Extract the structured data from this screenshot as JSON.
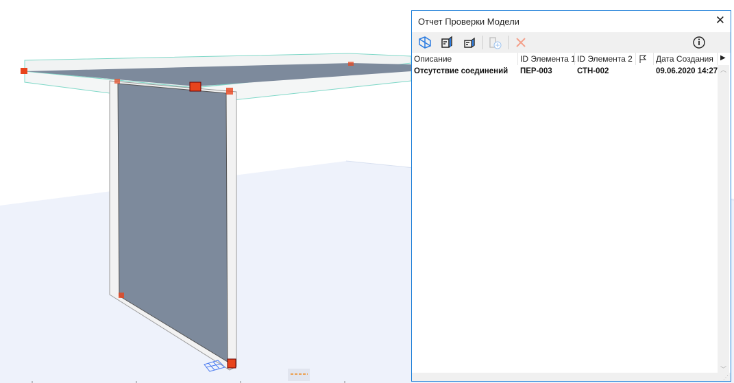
{
  "dialog": {
    "title": "Отчет Проверки Модели",
    "toolbar_icons": [
      "show-in-3d-icon",
      "select-element-1-icon",
      "select-element-2-icon",
      "add-issue-icon",
      "delete-icon",
      "info-icon"
    ],
    "columns": [
      "Описание",
      "ID Элемента 1",
      "ID Элемента 2",
      "flag-icon",
      "Дата Создания"
    ],
    "rows": [
      {
        "description": "Отсутствие соединений",
        "id1": "ПЕР-003",
        "id2": "СТН-002",
        "date": "09.06.2020 14:27"
      }
    ]
  },
  "colors": {
    "accent": "#1e7fd8",
    "wall": "#7d8a9c",
    "marker": "#e8441c",
    "ground": "#eef2fb"
  }
}
